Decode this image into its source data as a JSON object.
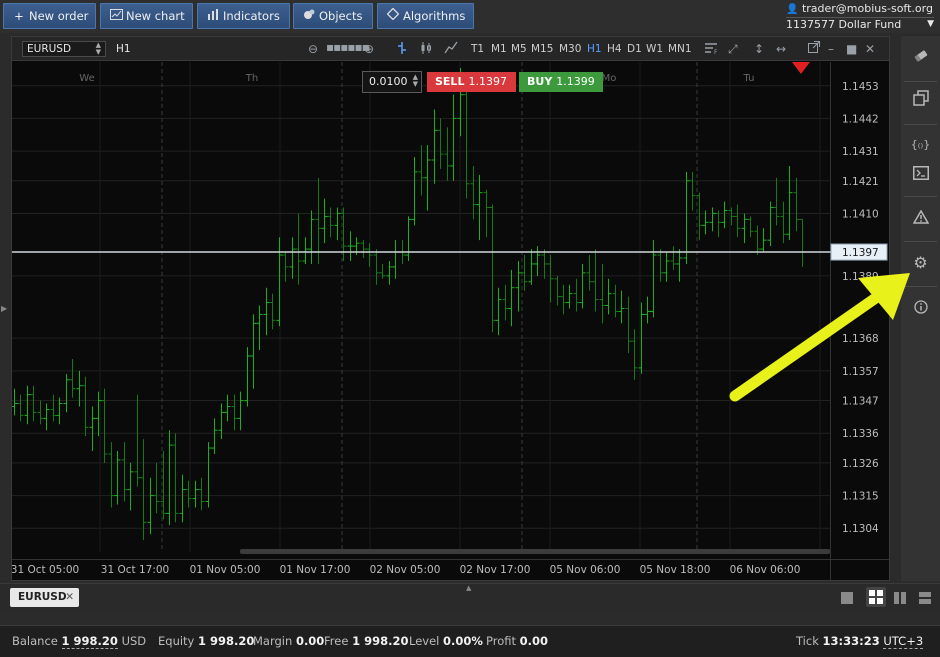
{
  "toolbar": {
    "new_order": "New order",
    "new_chart": "New chart",
    "indicators": "Indicators",
    "objects": "Objects",
    "algorithms": "Algorithms"
  },
  "account": {
    "email": "trader@mobius-soft.org",
    "id": "1137577",
    "name": "Dollar Fund"
  },
  "chart_header": {
    "symbol": "EURUSD",
    "timeframe": "H1",
    "timeframes": [
      "T1",
      "M1",
      "M5",
      "M15",
      "M30",
      "H1",
      "H4",
      "D1",
      "W1",
      "MN1"
    ],
    "active_timeframe": "H1"
  },
  "trade": {
    "quantity": "0.0100",
    "sell_label": "SELL",
    "sell_price": "1.1397",
    "buy_label": "BUY",
    "buy_price": "1.1399"
  },
  "chart_data": {
    "type": "ohlc",
    "symbol": "EURUSD",
    "timeframe": "H1",
    "current_price": 1.1397,
    "ylim": [
      1.1296,
      1.1461
    ],
    "y_ticks": [
      1.1453,
      1.1442,
      1.1431,
      1.1421,
      1.141,
      1.1389,
      1.1368,
      1.1357,
      1.1347,
      1.1336,
      1.1326,
      1.1315,
      1.1304
    ],
    "day_labels": [
      "We",
      "Th",
      "Mo",
      "Tu"
    ],
    "x_tick_labels": [
      "31 Oct 05:00",
      "31 Oct 17:00",
      "01 Nov 05:00",
      "01 Nov 17:00",
      "02 Nov 05:00",
      "02 Nov 17:00",
      "05 Nov 06:00",
      "05 Nov 18:00",
      "06 Nov 06:00"
    ],
    "bars": [
      [
        1.1345,
        1.1351,
        1.1342,
        1.1346
      ],
      [
        1.1346,
        1.1349,
        1.134,
        1.1342
      ],
      [
        1.1342,
        1.1352,
        1.1339,
        1.1349
      ],
      [
        1.1349,
        1.1352,
        1.134,
        1.1343
      ],
      [
        1.1343,
        1.1347,
        1.1339,
        1.1341
      ],
      [
        1.1341,
        1.1346,
        1.1337,
        1.1344
      ],
      [
        1.1344,
        1.1349,
        1.134,
        1.1342
      ],
      [
        1.1342,
        1.1348,
        1.1339,
        1.1346
      ],
      [
        1.1346,
        1.1356,
        1.1343,
        1.1354
      ],
      [
        1.1354,
        1.1361,
        1.1348,
        1.1351
      ],
      [
        1.1351,
        1.1357,
        1.1345,
        1.1352
      ],
      [
        1.1352,
        1.1355,
        1.1335,
        1.1338
      ],
      [
        1.1338,
        1.1345,
        1.133,
        1.1341
      ],
      [
        1.1341,
        1.135,
        1.1335,
        1.1347
      ],
      [
        1.1347,
        1.1351,
        1.1326,
        1.1329
      ],
      [
        1.1329,
        1.1333,
        1.1311,
        1.1315
      ],
      [
        1.1315,
        1.133,
        1.1312,
        1.1327
      ],
      [
        1.1327,
        1.1333,
        1.1313,
        1.1317
      ],
      [
        1.1317,
        1.1326,
        1.131,
        1.1323
      ],
      [
        1.1323,
        1.1349,
        1.1318,
        1.1321
      ],
      [
        1.1321,
        1.1334,
        1.13,
        1.1306
      ],
      [
        1.1306,
        1.1321,
        1.1302,
        1.1315
      ],
      [
        1.1315,
        1.1326,
        1.1309,
        1.1313
      ],
      [
        1.1313,
        1.133,
        1.1307,
        1.1309
      ],
      [
        1.1309,
        1.1337,
        1.1305,
        1.1332
      ],
      [
        1.1332,
        1.1336,
        1.1306,
        1.1309
      ],
      [
        1.1309,
        1.1322,
        1.1306,
        1.1317
      ],
      [
        1.1317,
        1.132,
        1.1311,
        1.1314
      ],
      [
        1.1314,
        1.132,
        1.1311,
        1.1317
      ],
      [
        1.1317,
        1.1321,
        1.131,
        1.1313
      ],
      [
        1.1313,
        1.1333,
        1.1311,
        1.1331
      ],
      [
        1.1331,
        1.1341,
        1.1329,
        1.1337
      ],
      [
        1.1337,
        1.1346,
        1.1334,
        1.1343
      ],
      [
        1.1343,
        1.1349,
        1.134,
        1.1345
      ],
      [
        1.1345,
        1.1349,
        1.1337,
        1.1341
      ],
      [
        1.1341,
        1.135,
        1.1337,
        1.1347
      ],
      [
        1.1347,
        1.1365,
        1.1345,
        1.1362
      ],
      [
        1.1362,
        1.1376,
        1.1351,
        1.1373
      ],
      [
        1.1373,
        1.1379,
        1.1364,
        1.1376
      ],
      [
        1.1376,
        1.1385,
        1.1369,
        1.138
      ],
      [
        1.138,
        1.1383,
        1.1371,
        1.1374
      ],
      [
        1.1374,
        1.1402,
        1.1372,
        1.1396
      ],
      [
        1.1396,
        1.1397,
        1.1387,
        1.1392
      ],
      [
        1.1392,
        1.1402,
        1.1388,
        1.1398
      ],
      [
        1.1398,
        1.141,
        1.1386,
        1.1394
      ],
      [
        1.1394,
        1.1402,
        1.1393,
        1.1398
      ],
      [
        1.1398,
        1.1411,
        1.1393,
        1.1408
      ],
      [
        1.1408,
        1.1422,
        1.1393,
        1.1405
      ],
      [
        1.1405,
        1.1415,
        1.14,
        1.1409
      ],
      [
        1.1409,
        1.1412,
        1.1402,
        1.1406
      ],
      [
        1.1406,
        1.1412,
        1.1401,
        1.141
      ],
      [
        1.141,
        1.1412,
        1.1394,
        1.1399
      ],
      [
        1.1399,
        1.1404,
        1.1394,
        1.1399
      ],
      [
        1.1399,
        1.1402,
        1.1396,
        1.14
      ],
      [
        1.14,
        1.1401,
        1.1395,
        1.1398
      ],
      [
        1.1398,
        1.14,
        1.1392,
        1.1396
      ],
      [
        1.1396,
        1.1398,
        1.1386,
        1.139
      ],
      [
        1.139,
        1.1393,
        1.1388,
        1.1389
      ],
      [
        1.1389,
        1.1394,
        1.1386,
        1.1392
      ],
      [
        1.1392,
        1.1401,
        1.1388,
        1.1397
      ],
      [
        1.1397,
        1.1401,
        1.1393,
        1.1396
      ],
      [
        1.1396,
        1.1409,
        1.1394,
        1.1408
      ],
      [
        1.1408,
        1.1429,
        1.1406,
        1.1424
      ],
      [
        1.1424,
        1.1433,
        1.1416,
        1.1422
      ],
      [
        1.1422,
        1.1433,
        1.1411,
        1.1428
      ],
      [
        1.1428,
        1.1445,
        1.142,
        1.1438
      ],
      [
        1.1438,
        1.1442,
        1.1425,
        1.143
      ],
      [
        1.143,
        1.1439,
        1.1421,
        1.1426
      ],
      [
        1.1426,
        1.145,
        1.1421,
        1.1442
      ],
      [
        1.1442,
        1.1459,
        1.1436,
        1.145
      ],
      [
        1.145,
        1.1451,
        1.1415,
        1.142
      ],
      [
        1.142,
        1.1426,
        1.1408,
        1.1413
      ],
      [
        1.1413,
        1.1423,
        1.1401,
        1.1417
      ],
      [
        1.1417,
        1.1418,
        1.1402,
        1.1412
      ],
      [
        1.1412,
        1.1413,
        1.137,
        1.1374
      ],
      [
        1.1374,
        1.1385,
        1.1369,
        1.1381
      ],
      [
        1.1381,
        1.1386,
        1.1374,
        1.1378
      ],
      [
        1.1378,
        1.1391,
        1.1372,
        1.1385
      ],
      [
        1.1385,
        1.1394,
        1.1377,
        1.139
      ],
      [
        1.139,
        1.1396,
        1.1384,
        1.1387
      ],
      [
        1.1387,
        1.1398,
        1.1386,
        1.1393
      ],
      [
        1.1393,
        1.1399,
        1.1389,
        1.1396
      ],
      [
        1.1396,
        1.1398,
        1.1388,
        1.1393
      ],
      [
        1.1393,
        1.1396,
        1.138,
        1.1388
      ],
      [
        1.1388,
        1.1389,
        1.1379,
        1.1382
      ],
      [
        1.1382,
        1.1386,
        1.1376,
        1.138
      ],
      [
        1.138,
        1.1386,
        1.1378,
        1.1383
      ],
      [
        1.1383,
        1.1388,
        1.1377,
        1.138
      ],
      [
        1.138,
        1.1393,
        1.1378,
        1.139
      ],
      [
        1.139,
        1.1396,
        1.1384,
        1.1387
      ],
      [
        1.1387,
        1.1398,
        1.1377,
        1.1381
      ],
      [
        1.1381,
        1.1393,
        1.1373,
        1.1379
      ],
      [
        1.1379,
        1.1388,
        1.1376,
        1.1383
      ],
      [
        1.1383,
        1.1386,
        1.1375,
        1.1377
      ],
      [
        1.1377,
        1.1384,
        1.1373,
        1.1378
      ],
      [
        1.1378,
        1.1382,
        1.1363,
        1.1367
      ],
      [
        1.1367,
        1.1371,
        1.1354,
        1.1358
      ],
      [
        1.1358,
        1.138,
        1.1356,
        1.1376
      ],
      [
        1.1376,
        1.1382,
        1.1373,
        1.1377
      ],
      [
        1.1377,
        1.1401,
        1.1375,
        1.1396
      ],
      [
        1.1396,
        1.1398,
        1.1387,
        1.139
      ],
      [
        1.139,
        1.1397,
        1.1387,
        1.1394
      ],
      [
        1.1394,
        1.1399,
        1.1391,
        1.1393
      ],
      [
        1.1393,
        1.1398,
        1.1387,
        1.1395
      ],
      [
        1.1395,
        1.1424,
        1.1393,
        1.1421
      ],
      [
        1.1421,
        1.1424,
        1.1411,
        1.1416
      ],
      [
        1.1416,
        1.1417,
        1.1401,
        1.1406
      ],
      [
        1.1406,
        1.1411,
        1.1403,
        1.1407
      ],
      [
        1.1407,
        1.1412,
        1.1404,
        1.141
      ],
      [
        1.141,
        1.1411,
        1.1402,
        1.1407
      ],
      [
        1.1407,
        1.1414,
        1.1405,
        1.1411
      ],
      [
        1.1411,
        1.1412,
        1.1406,
        1.1409
      ],
      [
        1.1409,
        1.1413,
        1.1402,
        1.1405
      ],
      [
        1.1405,
        1.141,
        1.14,
        1.1408
      ],
      [
        1.1408,
        1.1409,
        1.1402,
        1.1404
      ],
      [
        1.1404,
        1.1406,
        1.1396,
        1.1398
      ],
      [
        1.1398,
        1.1405,
        1.1397,
        1.1401
      ],
      [
        1.1401,
        1.1414,
        1.1399,
        1.1412
      ],
      [
        1.1412,
        1.1422,
        1.1406,
        1.1409
      ],
      [
        1.1409,
        1.1414,
        1.14,
        1.1403
      ],
      [
        1.1403,
        1.1426,
        1.1401,
        1.1417
      ],
      [
        1.1417,
        1.1422,
        1.1404,
        1.1408
      ],
      [
        1.1408,
        1.1408,
        1.1392,
        1.1397
      ]
    ]
  },
  "tabs": [
    {
      "label": "EURUSD",
      "close": "✕"
    }
  ],
  "status": {
    "balance_label": "Balance",
    "balance_value": "1 998.20",
    "balance_currency": "USD",
    "equity_label": "Equity",
    "equity_value": "1 998.20",
    "margin_label": "Margin",
    "margin_value": "0.00",
    "free_label": "Free",
    "free_value": "1 998.20",
    "level_label": "Level",
    "level_value": "0.00%",
    "profit_label": "Profit",
    "profit_value": "0.00",
    "tick_label": "Tick",
    "tick_time": "13:33:23",
    "timezone": "UTC+3"
  },
  "icons": {
    "new_order": "plus-icon",
    "new_chart": "chart-icon",
    "indicators": "bars-icon",
    "objects": "shapes-icon",
    "algorithms": "diamond-icon",
    "side": [
      "eraser-icon",
      "copy-icon",
      "code-braces-icon",
      "terminal-icon",
      "warning-icon",
      "gear-icon",
      "info-icon"
    ]
  },
  "colors": {
    "bar_up": "#19b319",
    "bar_down": "#157a15",
    "sell": "#d9393c",
    "buy": "#3c9a3c",
    "price_line": "#cfd8dc",
    "arrow": "#e8f21a",
    "toolbar_btn": "#3a5c8c"
  }
}
